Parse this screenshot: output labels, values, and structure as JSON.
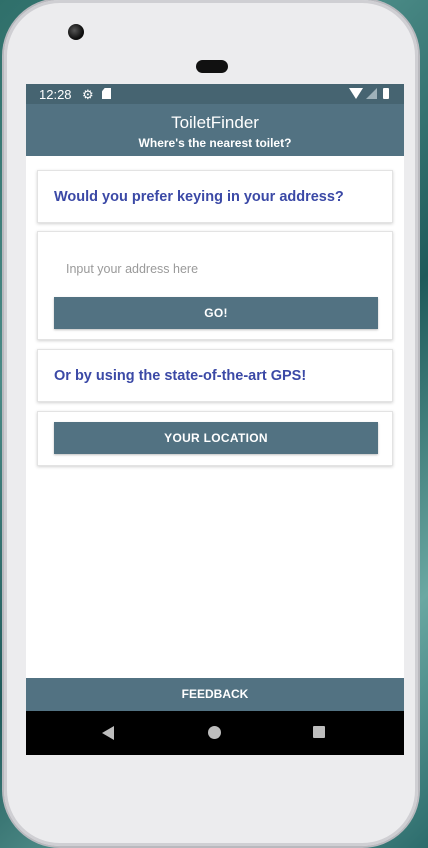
{
  "status_bar": {
    "time": "12:28",
    "icons": [
      "gear-icon",
      "sd-card-icon",
      "wifi-icon",
      "signal-icon",
      "battery-icon"
    ]
  },
  "app_bar": {
    "title": "ToiletFinder",
    "subtitle": "Where's the nearest toilet?"
  },
  "address_section": {
    "heading": "Would you prefer keying in your address?",
    "input_value": "",
    "input_placeholder": "Input your address here",
    "go_label": "GO!"
  },
  "gps_section": {
    "heading": "Or by using the state-of-the-art GPS!",
    "location_label": "YOUR LOCATION"
  },
  "footer": {
    "feedback_label": "FEEDBACK"
  },
  "nav_bar": {
    "icons": [
      "back-icon",
      "home-icon",
      "recents-icon"
    ]
  },
  "colors": {
    "primary": "#527282",
    "primary_dark": "#466471",
    "heading_text": "#3b49a6",
    "nav_background": "#000000"
  }
}
